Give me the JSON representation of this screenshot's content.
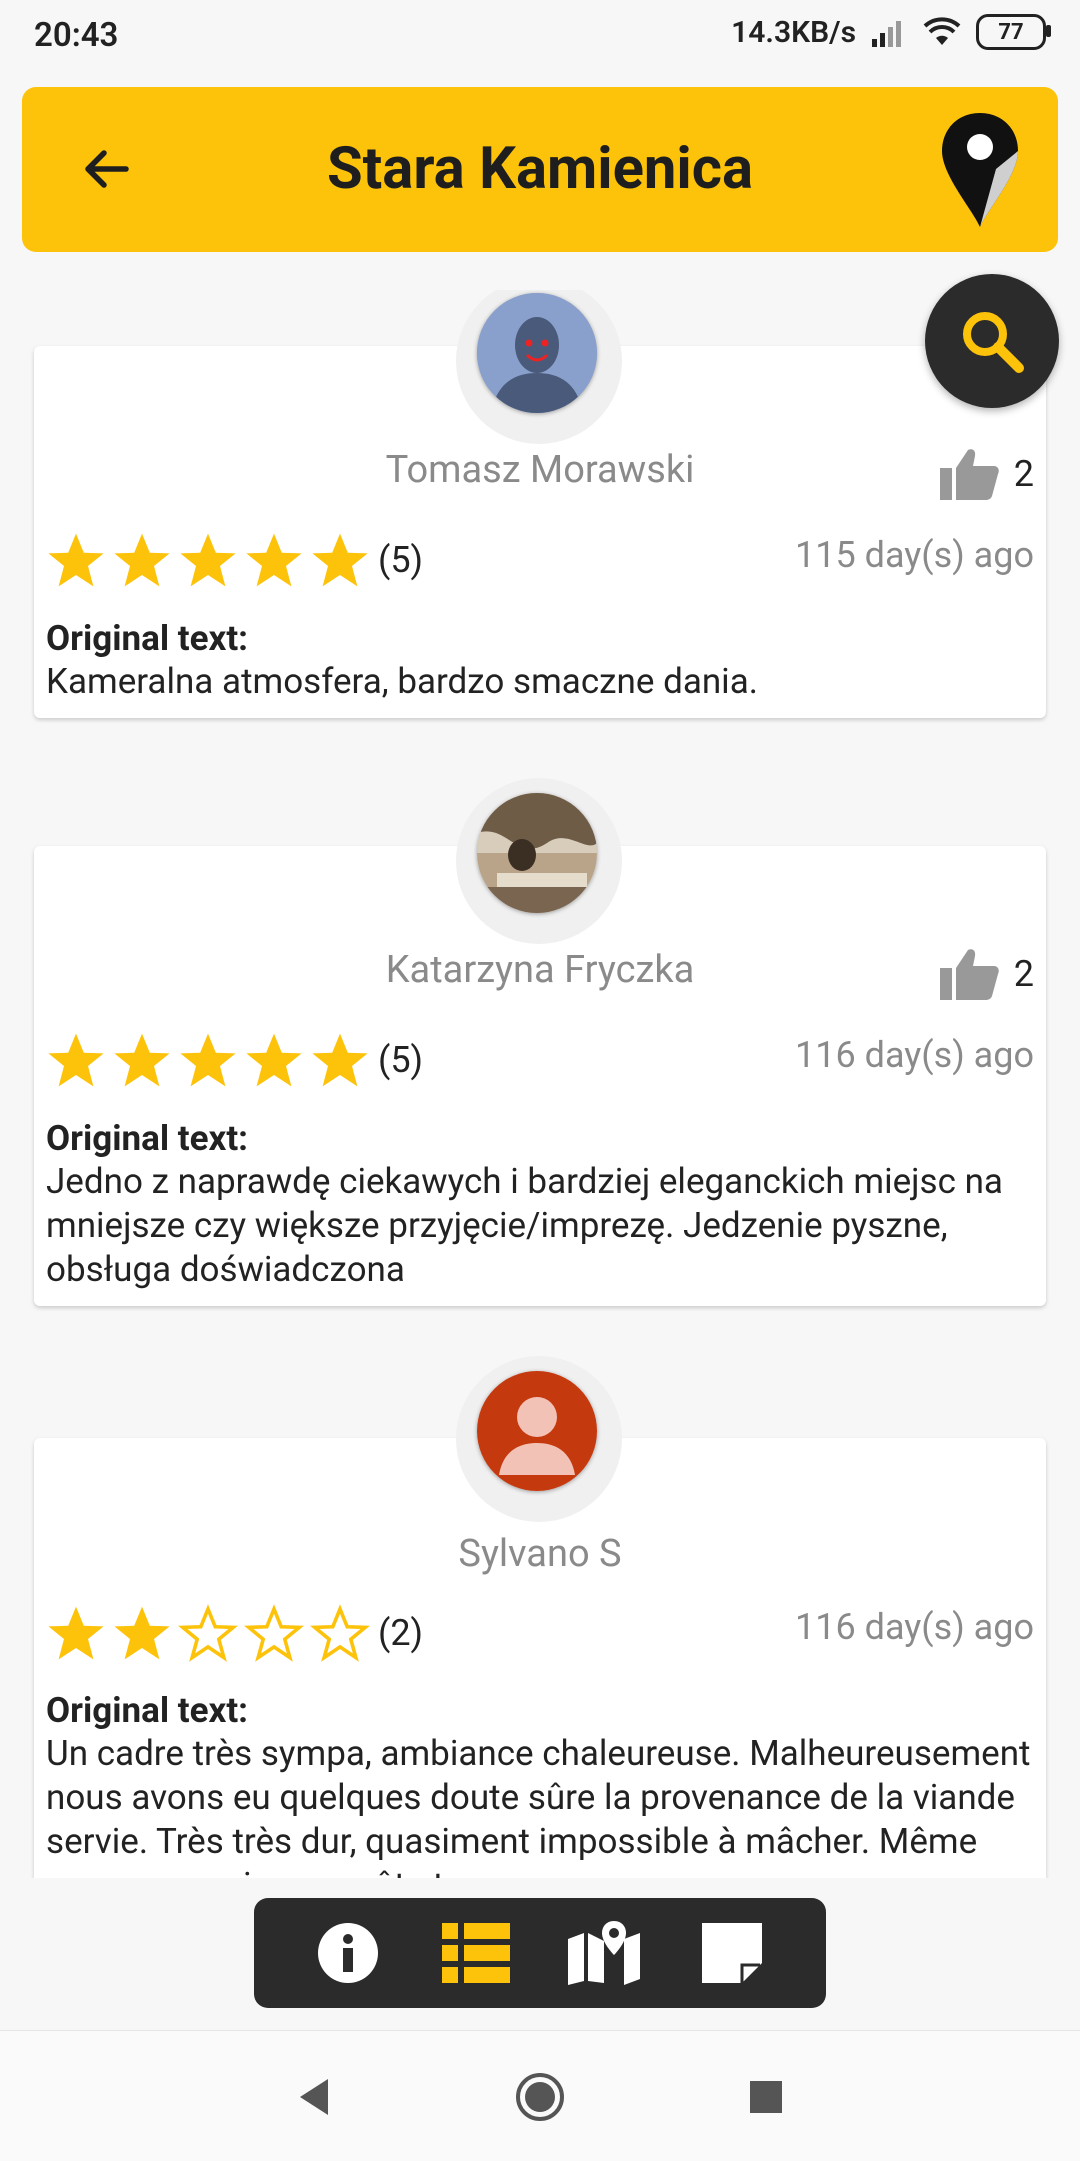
{
  "status_bar": {
    "time": "20:43",
    "net_speed": "14.3KB/s",
    "battery": "77"
  },
  "app_bar": {
    "title": "Stara Kamienica",
    "back_icon": "arrow-left-icon",
    "logo_icon": "map-pin-icon"
  },
  "search_fab": {
    "icon": "search-icon"
  },
  "reviews": [
    {
      "name": "Tomasz Morawski",
      "likes": "2",
      "stars": 5,
      "rating_label": "(5)",
      "ago": "115 day(s) ago",
      "original_label": "Original text:",
      "text": "Kameralna atmosfera, bardzo smaczne dania."
    },
    {
      "name": "Katarzyna Fryczka",
      "likes": "2",
      "stars": 5,
      "rating_label": "(5)",
      "ago": "116 day(s) ago",
      "original_label": "Original text:",
      "text": "Jedno z naprawdę ciekawych i bardziej eleganckich miejsc na mniejsze czy większe przyjęcie/imprezę. Jedzenie pyszne, obsługa doświadczona"
    },
    {
      "name": "Sylvano S",
      "likes": "",
      "stars": 2,
      "rating_label": "(2)",
      "ago": "116 day(s) ago",
      "original_label": "Original text:",
      "text": "Un cadre très sympa, ambiance chaleureuse. Malheureusement nous avons eu quelques doute sûre la provenance de la viande servie. Très très dur, quasiment impossible à mâcher. Même remarque qui a un goût et..."
    }
  ],
  "toolbar": {
    "items": [
      "info-icon",
      "list-icon",
      "map-icon",
      "note-icon"
    ],
    "active": "list-icon",
    "accent": "#fdc20a"
  },
  "colors": {
    "accent": "#fdc20a",
    "dark": "#2b2b2b"
  }
}
